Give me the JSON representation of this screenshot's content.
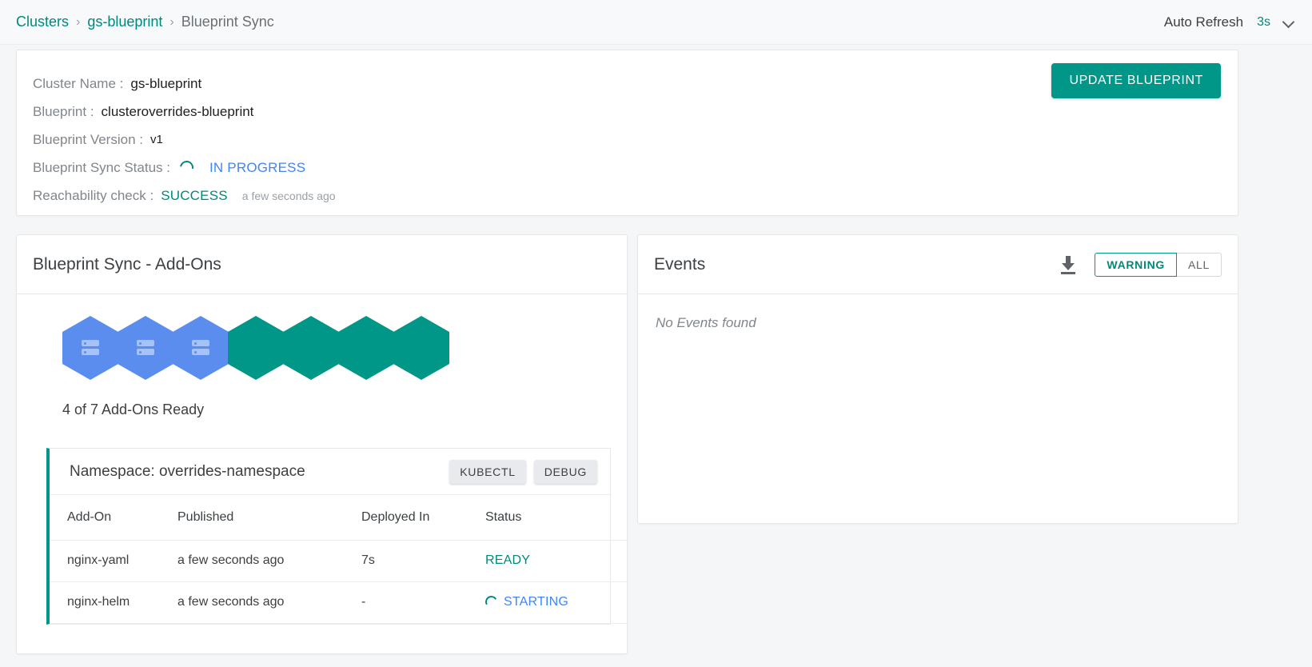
{
  "breadcrumb": {
    "items": [
      {
        "label": "Clusters",
        "type": "link"
      },
      {
        "label": "gs-blueprint",
        "type": "link"
      },
      {
        "label": "Blueprint Sync",
        "type": "current"
      }
    ],
    "separator": "›"
  },
  "auto_refresh": {
    "label": "Auto Refresh",
    "value": "3s",
    "chevron_icon": "chevron-down-icon"
  },
  "info": {
    "rows": [
      {
        "key": "Cluster Name :",
        "value": "gs-blueprint"
      },
      {
        "key": "Blueprint :",
        "value": "clusteroverrides-blueprint"
      },
      {
        "key": "Blueprint Version :",
        "value": "v1"
      }
    ],
    "sync_status_key": "Blueprint Sync Status :",
    "sync_status_value": "IN PROGRESS",
    "reachability_key": "Reachability check :",
    "reachability_value": "SUCCESS",
    "reachability_time": "a few seconds ago",
    "update_button": "UPDATE BLUEPRINT"
  },
  "addons_panel": {
    "title": "Blueprint Sync - Add-Ons",
    "hexagons": [
      {
        "state": "pending",
        "color": "#5b8def",
        "icon": "server-icon"
      },
      {
        "state": "pending",
        "color": "#5b8def",
        "icon": "server-icon"
      },
      {
        "state": "pending",
        "color": "#5b8def",
        "icon": "server-icon"
      },
      {
        "state": "ready",
        "color": "#009688",
        "icon": ""
      },
      {
        "state": "ready",
        "color": "#009688",
        "icon": ""
      },
      {
        "state": "ready",
        "color": "#009688",
        "icon": ""
      },
      {
        "state": "ready",
        "color": "#009688",
        "icon": ""
      }
    ],
    "ready_summary": "4 of 7 Add-Ons Ready",
    "namespace": {
      "title": "Namespace: overrides-namespace",
      "kubectl_button": "KUBECTL",
      "debug_button": "DEBUG"
    },
    "table": {
      "columns": [
        "Add-On",
        "Published",
        "Deployed In",
        "Status"
      ],
      "rows": [
        {
          "addon": "nginx-yaml",
          "published": "a few seconds ago",
          "deployed_in": "7s",
          "status": "READY",
          "status_state": "ready"
        },
        {
          "addon": "nginx-helm",
          "published": "a few seconds ago",
          "deployed_in": "-",
          "status": "STARTING",
          "status_state": "starting"
        }
      ]
    }
  },
  "events_panel": {
    "title": "Events",
    "download_icon": "download-icon",
    "filters": [
      {
        "label": "WARNING",
        "active": true
      },
      {
        "label": "ALL",
        "active": false
      }
    ],
    "empty_message": "No Events found"
  },
  "colors": {
    "accent_teal": "#009688",
    "link_teal": "#00897b",
    "progress_blue": "#4285f4",
    "hex_pending_blue": "#5b8def",
    "page_bg": "#f5f6f7"
  }
}
